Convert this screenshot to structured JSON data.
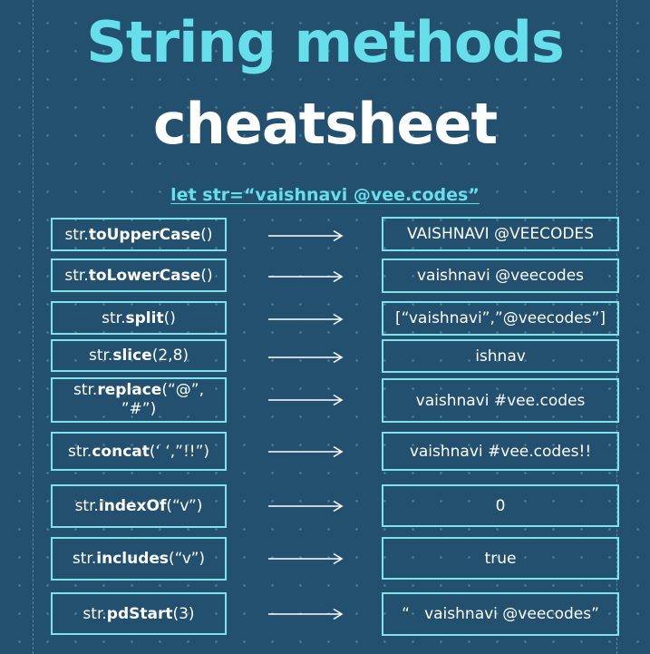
{
  "title": {
    "line1": "String methods",
    "line2": "cheatsheet"
  },
  "declaration": "let str=“vaishnavi @vee.codes”",
  "methods": [
    {
      "prefix": "str.",
      "name": "toUpperCase",
      "args": "()",
      "result": "VAISHNAVI @VEECODES"
    },
    {
      "prefix": "str.",
      "name": "toLowerCase",
      "args": "()",
      "result": "vaishnavi @veecodes"
    },
    {
      "prefix": "str.",
      "name": "split",
      "args": "()",
      "result": "[“vaishnavi”,”@veecodes”]"
    },
    {
      "prefix": "str.",
      "name": "slice",
      "args": "(2,8)",
      "result": "ishnav"
    },
    {
      "prefix": "str.",
      "name": "replace",
      "args": "(“@”, ”#”)",
      "result": "vaishnavi #vee.codes"
    },
    {
      "prefix": "str.",
      "name": "concat",
      "args": "(‘ ‘,”!!”)",
      "result": "vaishnavi #vee.codes!!"
    },
    {
      "prefix": "str.",
      "name": "indexOf",
      "args": "(“v”)",
      "result": "0"
    },
    {
      "prefix": "str.",
      "name": "includes",
      "args": "(“v”)",
      "result": "true"
    },
    {
      "prefix": "str.",
      "name": "pdStart",
      "args": "(3)",
      "result": "“   vaishnavi @veecodes”"
    }
  ],
  "colors": {
    "background": "#22506e",
    "accent": "#66dfea",
    "border": "#7fe3ec",
    "text": "#ffffff"
  }
}
